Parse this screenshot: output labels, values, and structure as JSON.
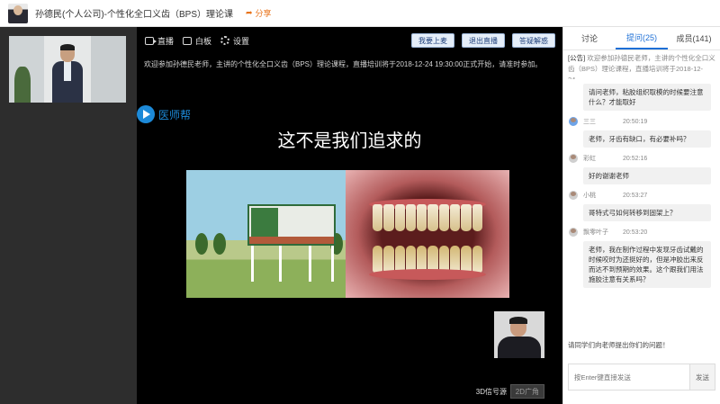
{
  "header": {
    "title": "孙德民(个人公司)-个性化全口义齿（BPS）理论课",
    "share_label": "分享"
  },
  "toolbar": {
    "live_label": "直播",
    "whiteboard_label": "白板",
    "settings_label": "设置",
    "buttons": [
      "我要上麦",
      "退出直播",
      "答疑解惑"
    ]
  },
  "stage": {
    "notice": "欢迎参加孙德民老师，主讲的个性化全口义齿（BPS）理论课程，直播培训将于2018-12-24 19:30:00正式开始，请准时参加。",
    "slide_logo": "医师帮",
    "slide_title": "这不是我们追求的",
    "signal_label": "3D信号源",
    "wide_label": "2D广角"
  },
  "panel": {
    "tabs": [
      "讨论",
      "提问(25)",
      "成员(141)"
    ],
    "active_tab": 1,
    "announcement_tag": "[公告]",
    "announcement": "欢迎参加孙德民老师，主讲的个性化全口义齿（BPS）理论课程，直播培训将于2018-12-24...",
    "messages": [
      {
        "text": "请问老师，粘胶组织取模的时候要注意什么？才能取好"
      },
      {
        "name": "三三",
        "time": "20:50:19",
        "text": "老师，牙齿有缺口，有必要补吗？"
      },
      {
        "name": "彩虹",
        "time": "20:52:16",
        "text": "好的谢谢老师"
      },
      {
        "name": "小桃",
        "time": "20:53:27",
        "text": "哥特式弓如何转移到固架上？"
      },
      {
        "name": "飘零叶子",
        "time": "20:53:20",
        "text": "老师，我在制作过程中发现牙齿试戴的时候咬时为还挺好的，但是冲胶出来反而达不到预期的效果。这个跟我们用法施胶注意有关系吗？"
      }
    ],
    "hint": "请同学们向老师提出你们的问题！",
    "input_placeholder": "按Enter键直接发送",
    "send_label": "发送"
  }
}
